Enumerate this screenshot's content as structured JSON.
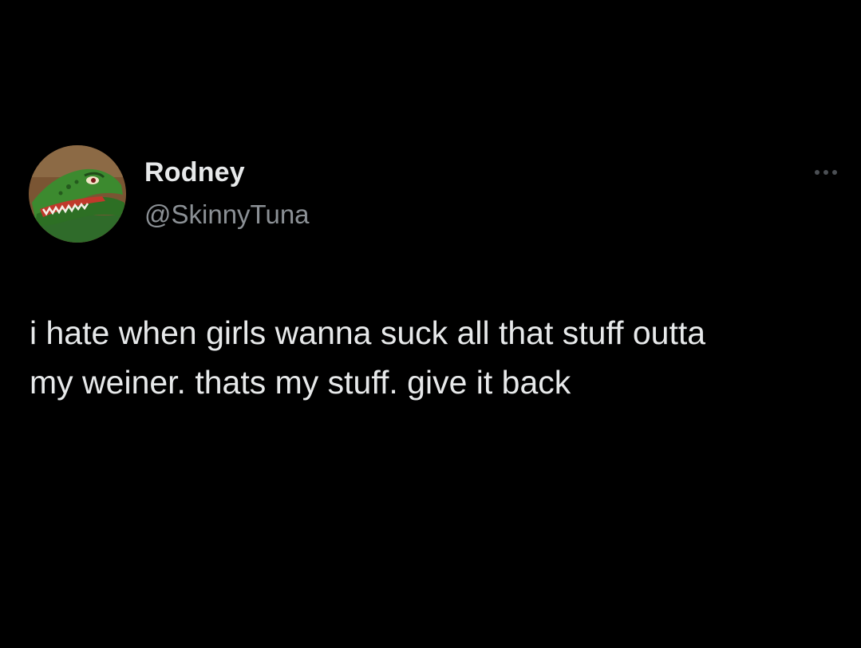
{
  "author": {
    "display_name": "Rodney",
    "handle": "@SkinnyTuna",
    "avatar_icon": "green-lizard-cartoon-avatar"
  },
  "more_icon": "ellipsis-icon",
  "tweet": {
    "lines": [
      "i hate when girls wanna suck all that stuff outta",
      "my weiner. thats my stuff. give it back"
    ]
  },
  "colors": {
    "background": "#000000",
    "text_primary": "#e7e9ea",
    "text_secondary": "#8b9095"
  }
}
